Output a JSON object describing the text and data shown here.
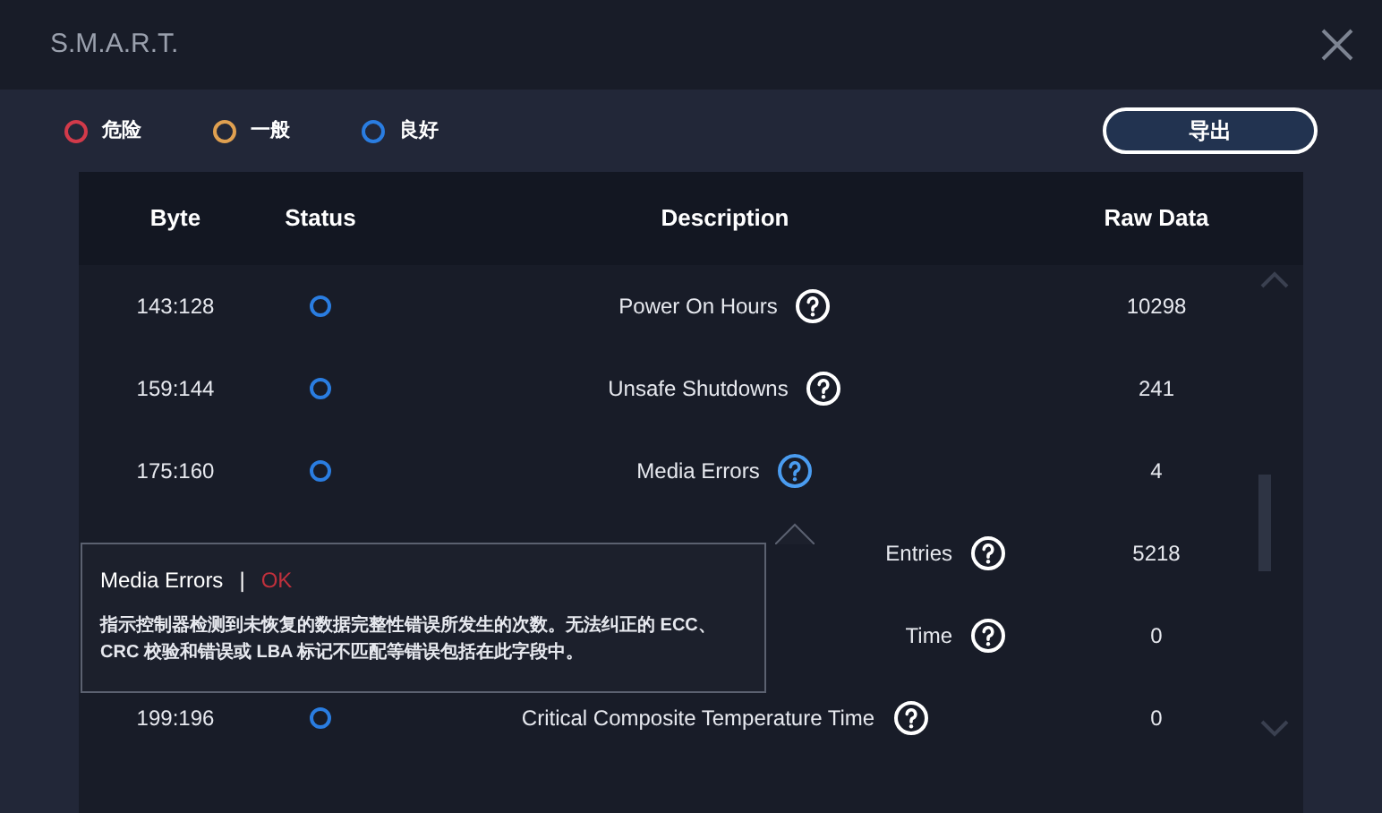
{
  "window": {
    "title": "S.M.A.R.T."
  },
  "legend": [
    {
      "label": "危险",
      "color": "#d23a4a"
    },
    {
      "label": "一般",
      "color": "#e0a050"
    },
    {
      "label": "良好",
      "color": "#2a7de1"
    }
  ],
  "export_button": "导出",
  "table": {
    "columns": [
      "Byte",
      "Status",
      "Description",
      "Raw Data"
    ],
    "rows": [
      {
        "byte": "143:128",
        "color": "#2a7de1",
        "description": "Power On Hours",
        "raw": "10298",
        "covered": false,
        "active": false
      },
      {
        "byte": "159:144",
        "color": "#2a7de1",
        "description": "Unsafe Shutdowns",
        "raw": "241",
        "covered": false,
        "active": false
      },
      {
        "byte": "175:160",
        "color": "#2a7de1",
        "description": "Media Errors",
        "raw": "4",
        "covered": false,
        "active": true
      },
      {
        "description": "Entries",
        "raw": "5218",
        "covered": true,
        "active": false
      },
      {
        "description": "Time",
        "raw": "0",
        "covered": true,
        "active": false
      },
      {
        "byte": "199:196",
        "color": "#2a7de1",
        "description": "Critical Composite Temperature Time",
        "raw": "0",
        "covered": false,
        "active": false
      }
    ]
  },
  "tooltip": {
    "title": "Media Errors",
    "separator": "|",
    "status": "OK",
    "text": "指示控制器检测到未恢复的数据完整性错误所发生的次数。无法纠正的 ECC、CRC 校验和错误或 LBA 标记不匹配等错误包括在此字段中。"
  }
}
